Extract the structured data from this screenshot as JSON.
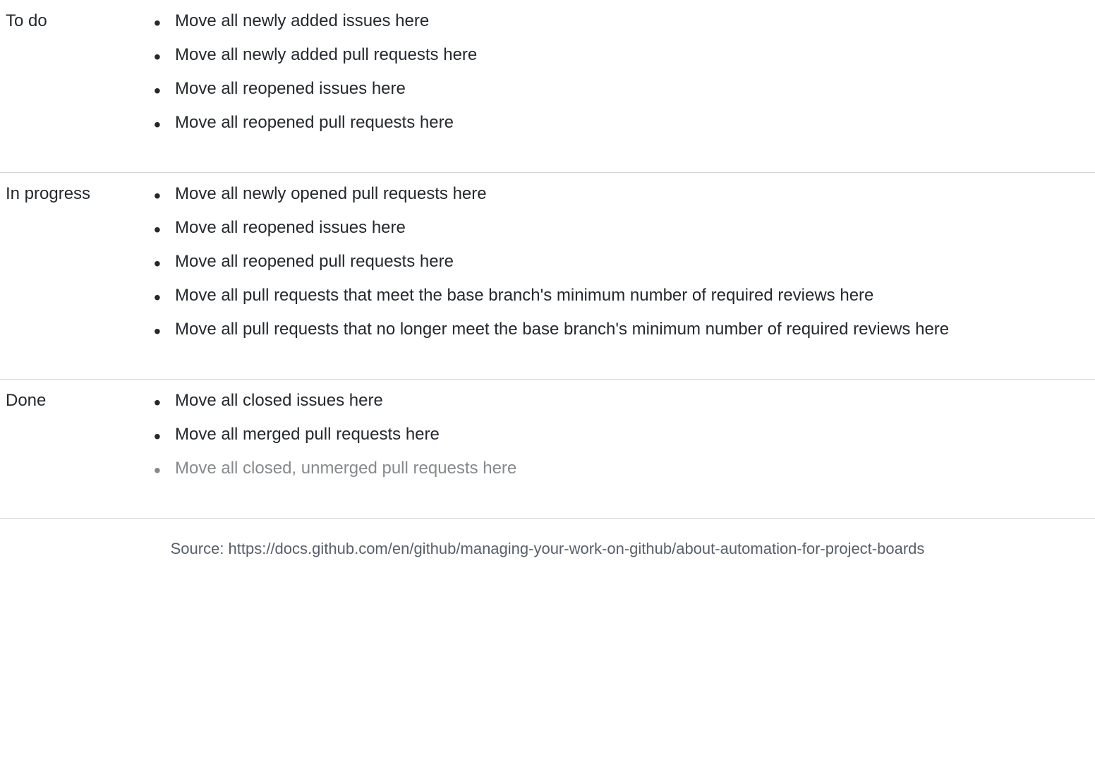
{
  "rows": [
    {
      "label": "To do",
      "items": [
        "Move all newly added issues here",
        "Move all newly added pull requests here",
        "Move all reopened issues here",
        "Move all reopened pull requests here"
      ]
    },
    {
      "label": "In progress",
      "items": [
        "Move all newly opened pull requests here",
        "Move all reopened issues here",
        "Move all reopened pull requests here",
        "Move all pull requests that meet the base branch's minimum number of required reviews here",
        "Move all pull requests that no longer meet the base branch's minimum number of required reviews here"
      ]
    },
    {
      "label": "Done",
      "items": [
        "Move all closed issues here",
        "Move all merged pull requests here",
        "Move all closed, unmerged pull requests here"
      ]
    }
  ],
  "source": "Source: https://docs.github.com/en/github/managing-your-work-on-github/about-automation-for-project-boards"
}
